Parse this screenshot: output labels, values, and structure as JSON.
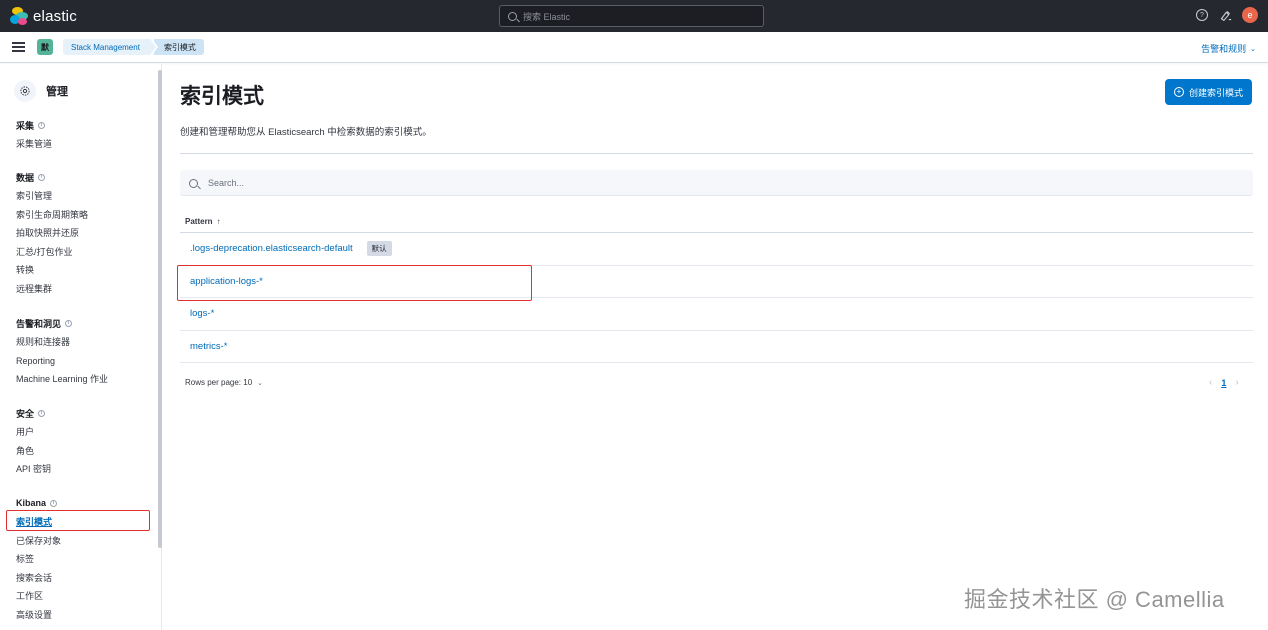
{
  "topbar": {
    "brand": "elastic",
    "search_placeholder": "搜索 Elastic",
    "avatar_initial": "e",
    "colors": {
      "bg": "#25282f",
      "avatar": "#e7664c"
    }
  },
  "subbar": {
    "space_badge": "默",
    "breadcrumbs": [
      "Stack Management",
      "索引模式"
    ],
    "alerts_link": "告警和规则"
  },
  "sidebar": {
    "title": "管理",
    "groups": [
      {
        "title": "采集",
        "items": [
          "采集管道"
        ]
      },
      {
        "title": "数据",
        "items": [
          "索引管理",
          "索引生命周期策略",
          "拍取快照并还原",
          "汇总/打包作业",
          "转换",
          "远程集群"
        ]
      },
      {
        "title": "告警和洞见",
        "items": [
          "规则和连接器",
          "Reporting",
          "Machine Learning 作业"
        ]
      },
      {
        "title": "安全",
        "items": [
          "用户",
          "角色",
          "API 密钥"
        ]
      },
      {
        "title": "Kibana",
        "items": [
          "索引模式",
          "已保存对象",
          "标签",
          "搜索会话",
          "工作区",
          "高级设置"
        ]
      }
    ],
    "active_item": "索引模式"
  },
  "main": {
    "title": "索引模式",
    "create_button": "创建索引模式",
    "description": "创建和管理帮助您从 Elasticsearch 中检索数据的索引模式。",
    "search_placeholder": "Search...",
    "table": {
      "column": "Pattern",
      "sort_arrow": "↑",
      "rows": [
        {
          "pattern": ".logs-deprecation.elasticsearch-default",
          "badge": "默认"
        },
        {
          "pattern": "application-logs-*"
        },
        {
          "pattern": "logs-*"
        },
        {
          "pattern": "metrics-*"
        }
      ]
    },
    "rows_per_page": "Rows per page: 10",
    "pagination": {
      "current": "1"
    }
  },
  "watermark": "掘金技术社区 @ Camellia",
  "colors": {
    "accent": "#0077cc",
    "link": "#006bb8",
    "highlight_box": "#e0312f"
  }
}
